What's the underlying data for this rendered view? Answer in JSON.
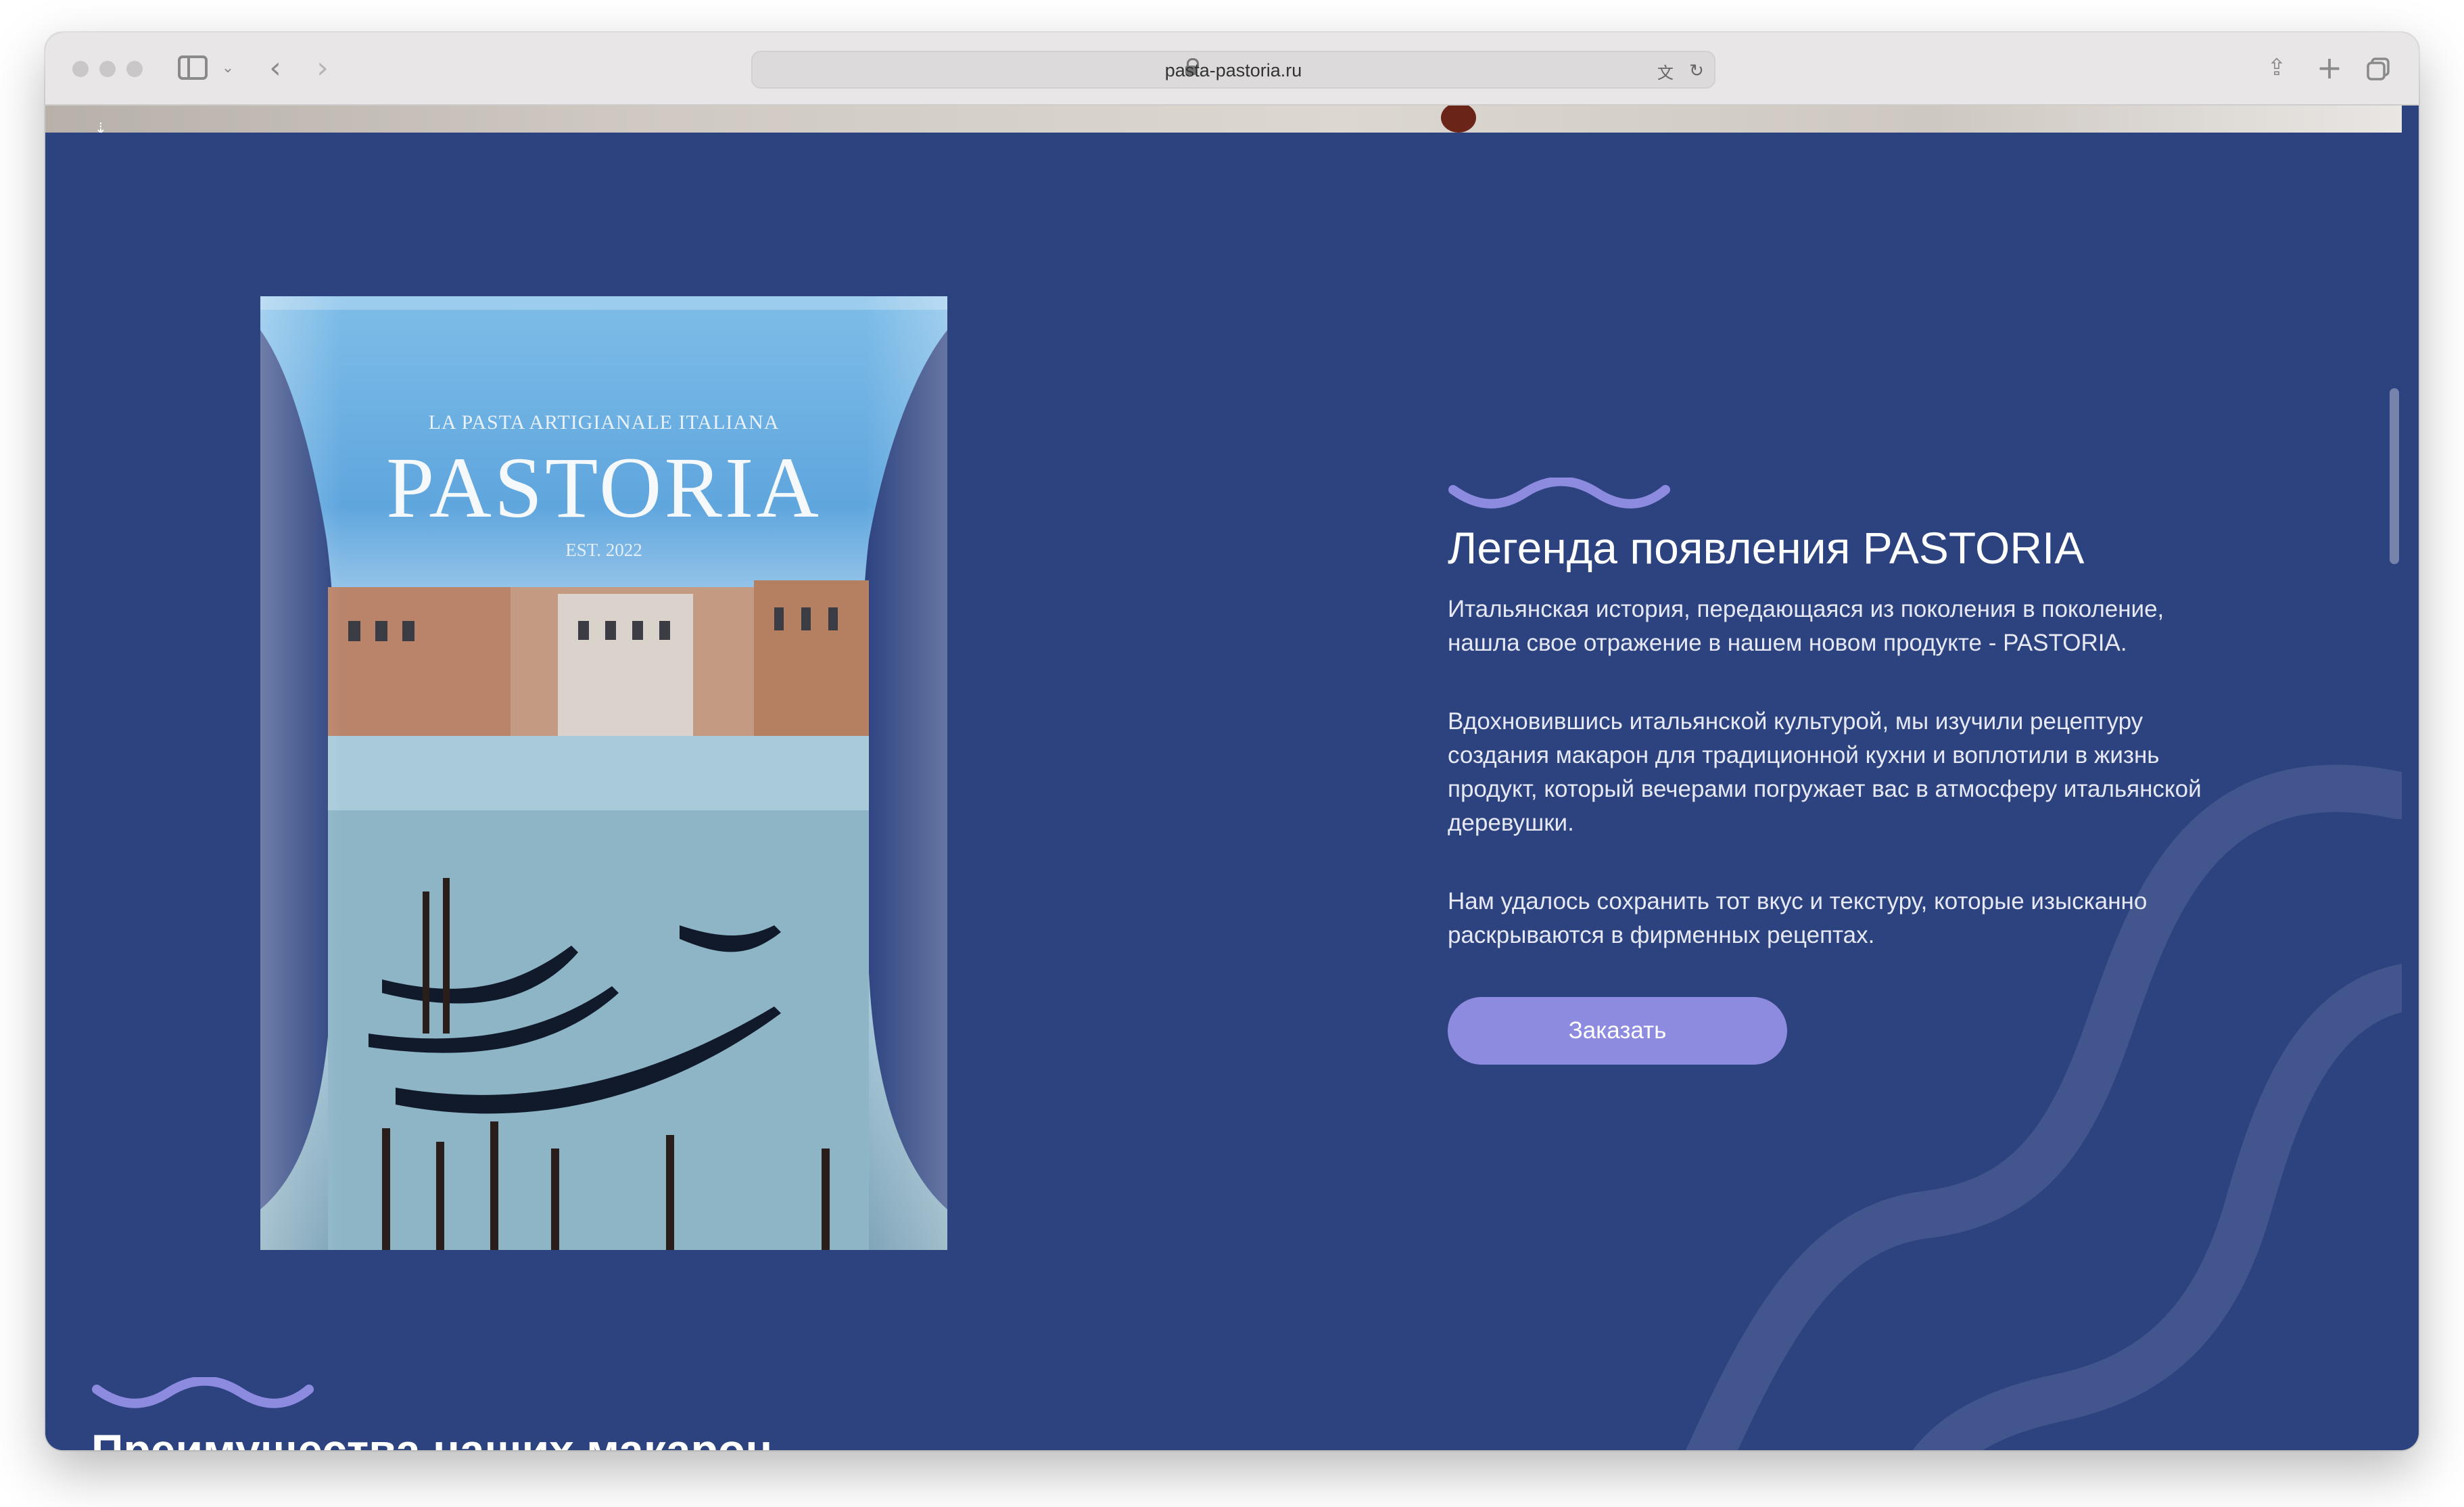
{
  "browser": {
    "url": "pasta-pastoria.ru"
  },
  "product_bag": {
    "tagline": "LA PASTA ARTIGIANALE ITALIANA",
    "brand": "PASTORIA",
    "established": "EST. 2022"
  },
  "legend": {
    "title": "Легенда появления PASTORIA",
    "paragraph1": "Итальянская история, передающаяся из поколения в поколение, нашла свое отражение в нашем новом продукте - PASTORIA.",
    "paragraph2": "Вдохновившись итальянской культурой, мы изучили рецептуру создания макарон для традиционной кухни и воплотили в жизнь продукт, который вечерами погружает вас в атмосферу итальянской деревушки.",
    "paragraph3": "Нам удалось сохранить тот вкус и текстуру, которые изысканно раскрываются в фирменных рецептах.",
    "order_button": "Заказать"
  },
  "advantages": {
    "title": "Преимущества наших макарон"
  },
  "colors": {
    "page_background": "#2d4380",
    "accent_wave": "#8d8be0",
    "button": "#8d8be0",
    "text": "#ffffff"
  },
  "icons": [
    "sidebar-icon",
    "chevron-down-icon",
    "back-icon",
    "forward-icon",
    "lock-icon",
    "translate-icon",
    "reload-icon",
    "share-icon",
    "new-tab-icon",
    "tabs-overview-icon",
    "wave-icon"
  ]
}
